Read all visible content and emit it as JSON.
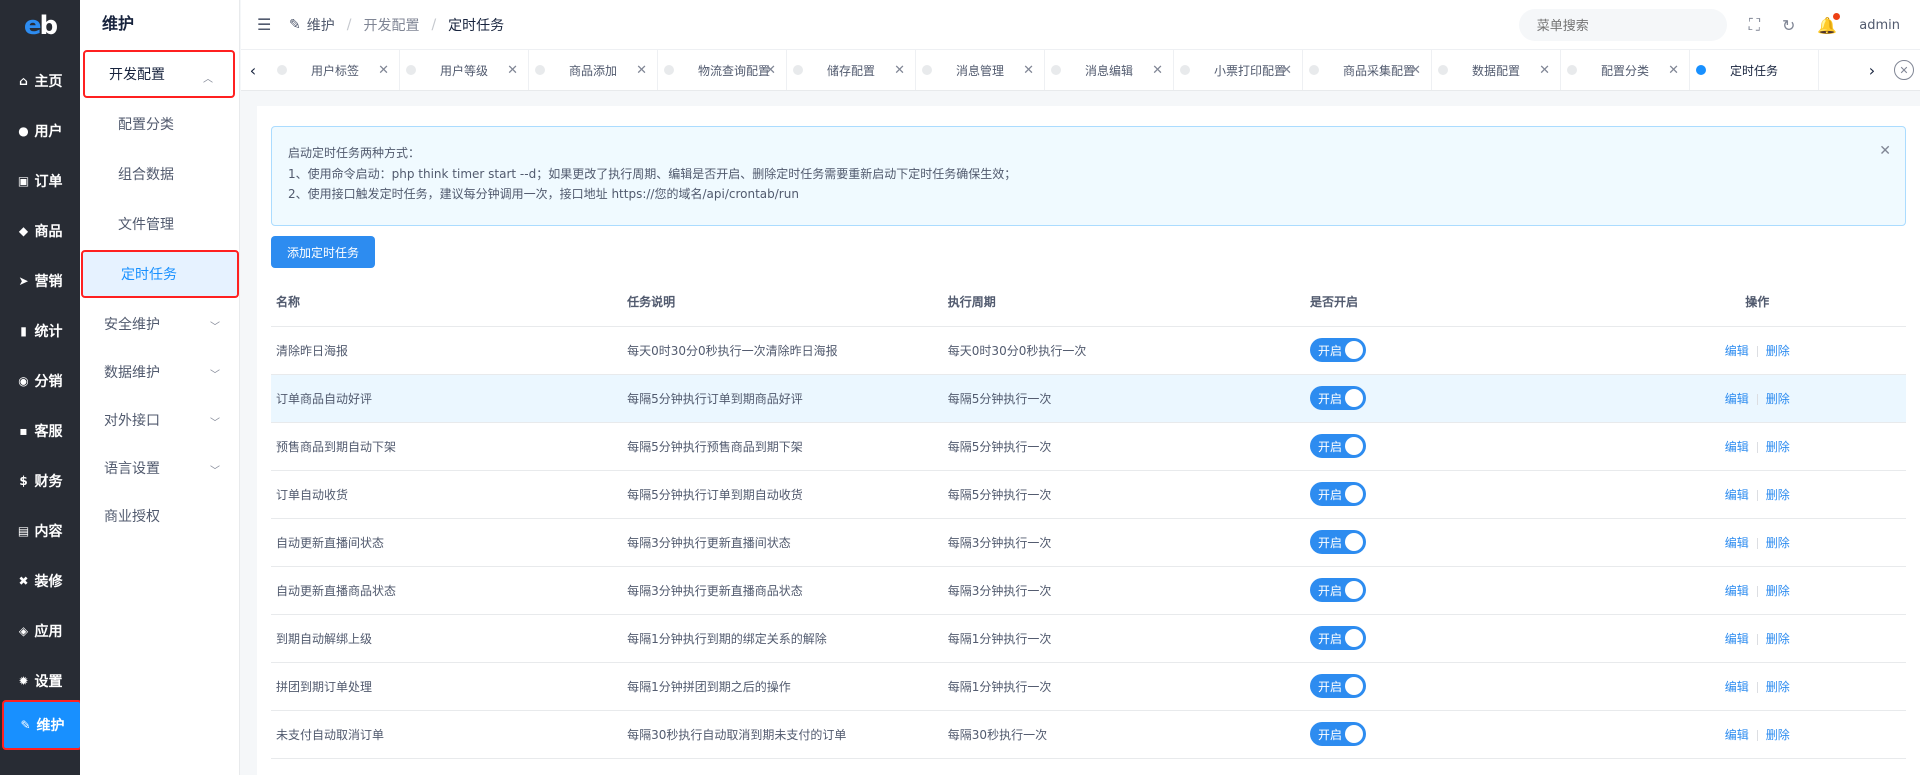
{
  "logo": "eb",
  "rail": [
    {
      "label": "主页",
      "icon": "home-icon",
      "glyph": "⌂"
    },
    {
      "label": "用户",
      "icon": "user-icon",
      "glyph": "●"
    },
    {
      "label": "订单",
      "icon": "cart-icon",
      "glyph": "▣"
    },
    {
      "label": "商品",
      "icon": "product-icon",
      "glyph": "◆"
    },
    {
      "label": "营销",
      "icon": "send-icon",
      "glyph": "➤"
    },
    {
      "label": "统计",
      "icon": "bar-chart-icon",
      "glyph": "▮"
    },
    {
      "label": "分销",
      "icon": "distribution-icon",
      "glyph": "◉"
    },
    {
      "label": "客服",
      "icon": "chat-icon",
      "glyph": "▪"
    },
    {
      "label": "财务",
      "icon": "dollar-icon",
      "glyph": "$"
    },
    {
      "label": "内容",
      "icon": "book-icon",
      "glyph": "▤"
    },
    {
      "label": "装修",
      "icon": "tools-icon",
      "glyph": "✖"
    },
    {
      "label": "应用",
      "icon": "cube-icon",
      "glyph": "◈"
    },
    {
      "label": "设置",
      "icon": "gear-icon",
      "glyph": "✹"
    },
    {
      "label": "维护",
      "icon": "wrench-icon",
      "glyph": "✎"
    }
  ],
  "submenu": {
    "title": "维护",
    "items": [
      {
        "label": "开发配置",
        "state": "open",
        "chevron": "︿"
      },
      {
        "label": "配置分类",
        "state": "child"
      },
      {
        "label": "组合数据",
        "state": "child"
      },
      {
        "label": "文件管理",
        "state": "child"
      },
      {
        "label": "定时任务",
        "state": "selected"
      },
      {
        "label": "安全维护",
        "state": "group",
        "chevron": "﹀"
      },
      {
        "label": "数据维护",
        "state": "group",
        "chevron": "﹀"
      },
      {
        "label": "对外接口",
        "state": "group",
        "chevron": "﹀"
      },
      {
        "label": "语言设置",
        "state": "group",
        "chevron": "﹀"
      },
      {
        "label": "商业授权",
        "state": "plain"
      }
    ]
  },
  "header": {
    "breadcrumb": [
      "维护",
      "开发配置",
      "定时任务"
    ],
    "search_placeholder": "菜单搜索",
    "user": "admin"
  },
  "tabs": [
    {
      "label": "用户标签",
      "active": false
    },
    {
      "label": "用户等级",
      "active": false
    },
    {
      "label": "商品添加",
      "active": false
    },
    {
      "label": "物流查询配置",
      "active": false
    },
    {
      "label": "储存配置",
      "active": false
    },
    {
      "label": "消息管理",
      "active": false
    },
    {
      "label": "消息编辑",
      "active": false
    },
    {
      "label": "小票打印配置",
      "active": false
    },
    {
      "label": "商品采集配置",
      "active": false
    },
    {
      "label": "数据配置",
      "active": false
    },
    {
      "label": "配置分类",
      "active": false
    },
    {
      "label": "定时任务",
      "active": true
    }
  ],
  "alert": {
    "lines": [
      "启动定时任务两种方式：",
      "1、使用命令启动：php think timer start --d；如果更改了执行周期、编辑是否开启、删除定时任务需要重新启动下定时任务确保生效；",
      "2、使用接口触发定时任务，建议每分钟调用一次，接口地址 https://您的域名/api/crontab/run"
    ]
  },
  "add_button": "添加定时任务",
  "table": {
    "columns": [
      "名称",
      "任务说明",
      "执行周期",
      "是否开启",
      "操作"
    ],
    "switch_on_label": "开启",
    "edit_label": "编辑",
    "delete_label": "删除",
    "rows": [
      {
        "name": "清除昨日海报",
        "desc": "每天0时30分0秒执行一次清除昨日海报",
        "period": "每天0时30分0秒执行一次",
        "enabled": true
      },
      {
        "name": "订单商品自动好评",
        "desc": "每隔5分钟执行订单到期商品好评",
        "period": "每隔5分钟执行一次",
        "enabled": true
      },
      {
        "name": "预售商品到期自动下架",
        "desc": "每隔5分钟执行预售商品到期下架",
        "period": "每隔5分钟执行一次",
        "enabled": true
      },
      {
        "name": "订单自动收货",
        "desc": "每隔5分钟执行订单到期自动收货",
        "period": "每隔5分钟执行一次",
        "enabled": true
      },
      {
        "name": "自动更新直播间状态",
        "desc": "每隔3分钟执行更新直播间状态",
        "period": "每隔3分钟执行一次",
        "enabled": true
      },
      {
        "name": "自动更新直播商品状态",
        "desc": "每隔3分钟执行更新直播商品状态",
        "period": "每隔3分钟执行一次",
        "enabled": true
      },
      {
        "name": "到期自动解绑上级",
        "desc": "每隔1分钟执行到期的绑定关系的解除",
        "period": "每隔1分钟执行一次",
        "enabled": true
      },
      {
        "name": "拼团到期订单处理",
        "desc": "每隔1分钟拼团到期之后的操作",
        "period": "每隔1分钟执行一次",
        "enabled": true
      },
      {
        "name": "未支付自动取消订单",
        "desc": "每隔30秒执行自动取消到期未支付的订单",
        "period": "每隔30秒执行一次",
        "enabled": true
      }
    ]
  },
  "colors": {
    "accent": "#1890ff",
    "primary_button": "#2d8cf0",
    "rail_bg": "#282c34",
    "highlight_border": "#ff2020"
  }
}
